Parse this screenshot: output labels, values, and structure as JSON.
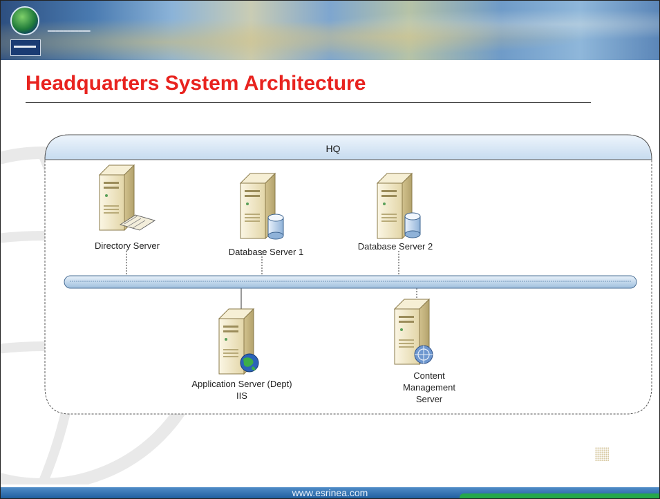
{
  "slide": {
    "title": "Headquarters System Architecture",
    "footer_url": "www.esrinea.com"
  },
  "diagram": {
    "group_label": "HQ",
    "servers": [
      {
        "id": "directory",
        "label": "Directory Server",
        "badge": "keyboard-icon"
      },
      {
        "id": "db1",
        "label": "Database Server 1",
        "badge": "database-cylinder-icon"
      },
      {
        "id": "db2",
        "label": "Database Server 2",
        "badge": "database-cylinder-icon"
      },
      {
        "id": "app",
        "label_lines": [
          "Application Server (Dept)",
          "IIS"
        ],
        "badge": "globe-icon"
      },
      {
        "id": "cms",
        "label_lines": [
          "Content",
          "Management",
          "Server"
        ],
        "badge": "web-globe-icon"
      }
    ],
    "network_bus": "ethernet-bus"
  },
  "colors": {
    "title": "#e8231f",
    "group_header": "#dbe9f6",
    "bus": "#c9dcee",
    "server_body": "#efe6c6"
  }
}
